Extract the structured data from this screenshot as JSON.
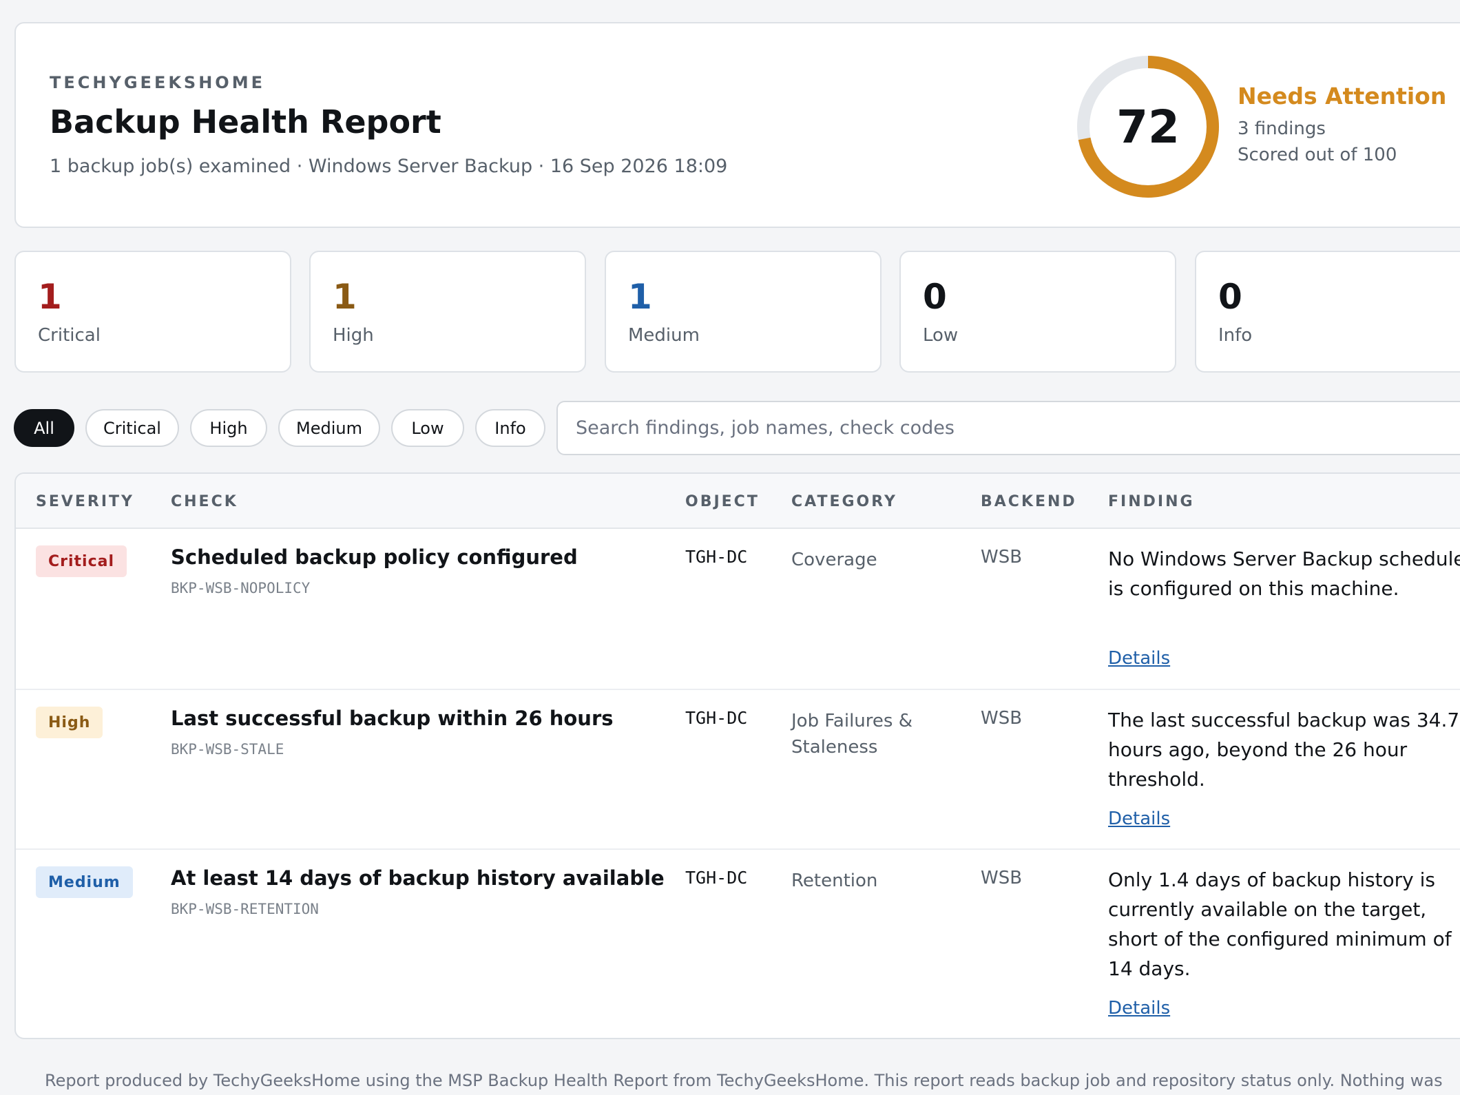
{
  "header": {
    "brand": "TECHYGEEKSHOME",
    "title": "Backup Health Report",
    "subtitle": "1 backup job(s) examined · Windows Server Backup · 16 Sep 2026 18:09",
    "score": "72",
    "score_fraction": 0.72,
    "status": "Needs Attention",
    "findings_count": "3 findings",
    "scored_out_of": "Scored out of 100",
    "colors": {
      "gauge_fill": "#d48a1e",
      "gauge_track": "#e4e7eb"
    }
  },
  "summary": [
    {
      "count": "1",
      "label": "Critical",
      "color": "#a31d1d"
    },
    {
      "count": "1",
      "label": "High",
      "color": "#8a5a14"
    },
    {
      "count": "1",
      "label": "Medium",
      "color": "#1f5fa8"
    },
    {
      "count": "0",
      "label": "Low",
      "color": "#111418"
    },
    {
      "count": "0",
      "label": "Info",
      "color": "#111418"
    }
  ],
  "filters": {
    "pills": [
      "All",
      "Critical",
      "High",
      "Medium",
      "Low",
      "Info"
    ],
    "active": "All",
    "search_placeholder": "Search findings, job names, check codes"
  },
  "table": {
    "columns": [
      "SEVERITY",
      "CHECK",
      "OBJECT",
      "CATEGORY",
      "BACKEND",
      "FINDING"
    ],
    "rows": [
      {
        "severity": "Critical",
        "title": "Scheduled backup policy configured",
        "code": "BKP-WSB-NOPOLICY",
        "object": "TGH-DC",
        "category": "Coverage",
        "backend": "WSB",
        "finding": "No Windows Server Backup schedule is configured on this machine.",
        "details": "Details"
      },
      {
        "severity": "High",
        "title": "Last successful backup within 26 hours",
        "code": "BKP-WSB-STALE",
        "object": "TGH-DC",
        "category": "Job Failures & Staleness",
        "backend": "WSB",
        "finding": "The last successful backup was 34.7 hours ago, beyond the 26 hour threshold.",
        "details": "Details"
      },
      {
        "severity": "Medium",
        "title": "At least 14 days of backup history available",
        "code": "BKP-WSB-RETENTION",
        "object": "TGH-DC",
        "category": "Retention",
        "backend": "WSB",
        "finding": "Only 1.4 days of backup history is currently available on the target, short of the configured minimum of 14 days.",
        "details": "Details"
      }
    ],
    "badge_colors": {
      "Critical": {
        "bg": "#fbe2e2",
        "fg": "#a31d1d"
      },
      "High": {
        "bg": "#fdf0d8",
        "fg": "#8a5a14"
      },
      "Medium": {
        "bg": "#e0ecfa",
        "fg": "#1f5fa8"
      }
    }
  },
  "footer": "Report produced by TechyGeeksHome using the MSP Backup Health Report from TechyGeeksHome. This report reads backup job and repository status only. Nothing was"
}
